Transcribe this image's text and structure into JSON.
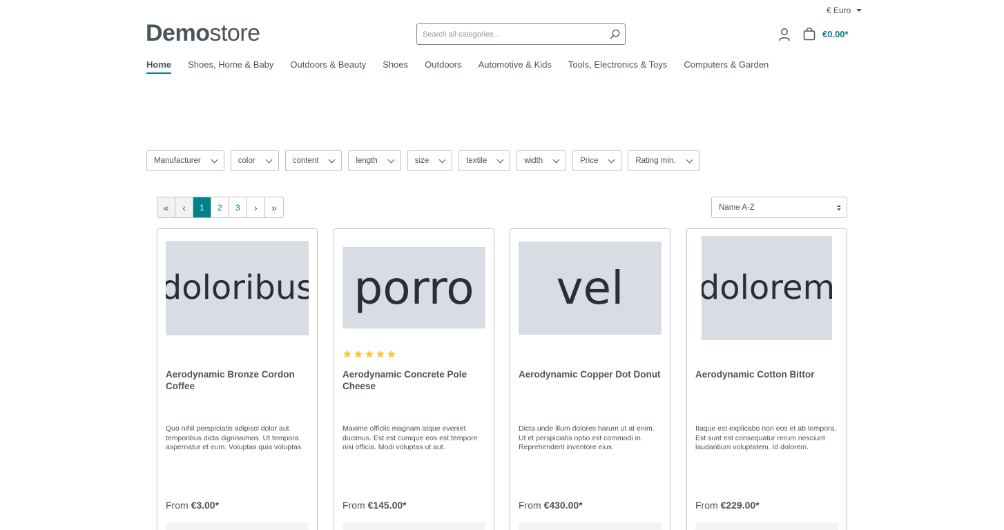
{
  "header": {
    "currency": "€ Euro",
    "logo_bold": "Demo",
    "logo_light": "store",
    "search_placeholder": "Search all categories...",
    "cart_total": "€0.00*"
  },
  "nav": [
    {
      "label": "Home",
      "active": true
    },
    {
      "label": "Shoes, Home & Baby"
    },
    {
      "label": "Outdoors & Beauty"
    },
    {
      "label": "Shoes"
    },
    {
      "label": "Outdoors"
    },
    {
      "label": "Automotive & Kids"
    },
    {
      "label": "Tools, Electronics & Toys"
    },
    {
      "label": "Computers & Garden"
    }
  ],
  "filters": [
    "Manufacturer",
    "color",
    "content",
    "length",
    "size",
    "textile",
    "width",
    "Price",
    "Rating min."
  ],
  "pagination": {
    "first": "«",
    "prev": "‹",
    "pages": [
      "1",
      "2",
      "3"
    ],
    "current": "1",
    "next": "›",
    "last": "»"
  },
  "sort": {
    "selected": "Name A-Z"
  },
  "products": [
    {
      "image_text": "doloribus",
      "name": "Aerodynamic Bronze Cordon Coffee",
      "description": "Quo nihil perspiciatis adipisci dolor aut temporibus dicta dignissimos. Ut tempora aspernatur et eum. Voluptas quia voluptas.",
      "price_prefix": "From",
      "price": "€3.00*",
      "rating": 0
    },
    {
      "image_text": "porro",
      "name": "Aerodynamic Concrete Pole Cheese",
      "description": "Maxime officiis magnam atque eveniet ducimus. Est est cumque eos est tempore nisi officia. Modi voluptas ut aut.",
      "price_prefix": "From",
      "price": "€145.00*",
      "rating": 5
    },
    {
      "image_text": "vel",
      "name": "Aerodynamic Copper Dot Donut",
      "description": "Dicta unde illum dolores harum ut at enim. Ut et perspiciatis optio est commodi in. Reprehenderit inventore eius.",
      "price_prefix": "From",
      "price": "€430.00*",
      "rating": 0
    },
    {
      "image_text": "dolorem",
      "name": "Aerodynamic Cotton Bittor",
      "description": "Itaque est explicabo non eos et ab tempora. Est sunt est consequatur rerum nesciunt laudantium voluptatem. Id dolorem.",
      "price_prefix": "From",
      "price": "€229.00*",
      "rating": 0
    }
  ],
  "colors": {
    "accent": "#00828a",
    "text": "#4a545b",
    "placeholder_bg": "#d8dce3",
    "star": "#ffc639"
  },
  "icons": [
    "search-icon",
    "account-icon",
    "cart-icon",
    "star-icon",
    "chevron-down-icon"
  ]
}
